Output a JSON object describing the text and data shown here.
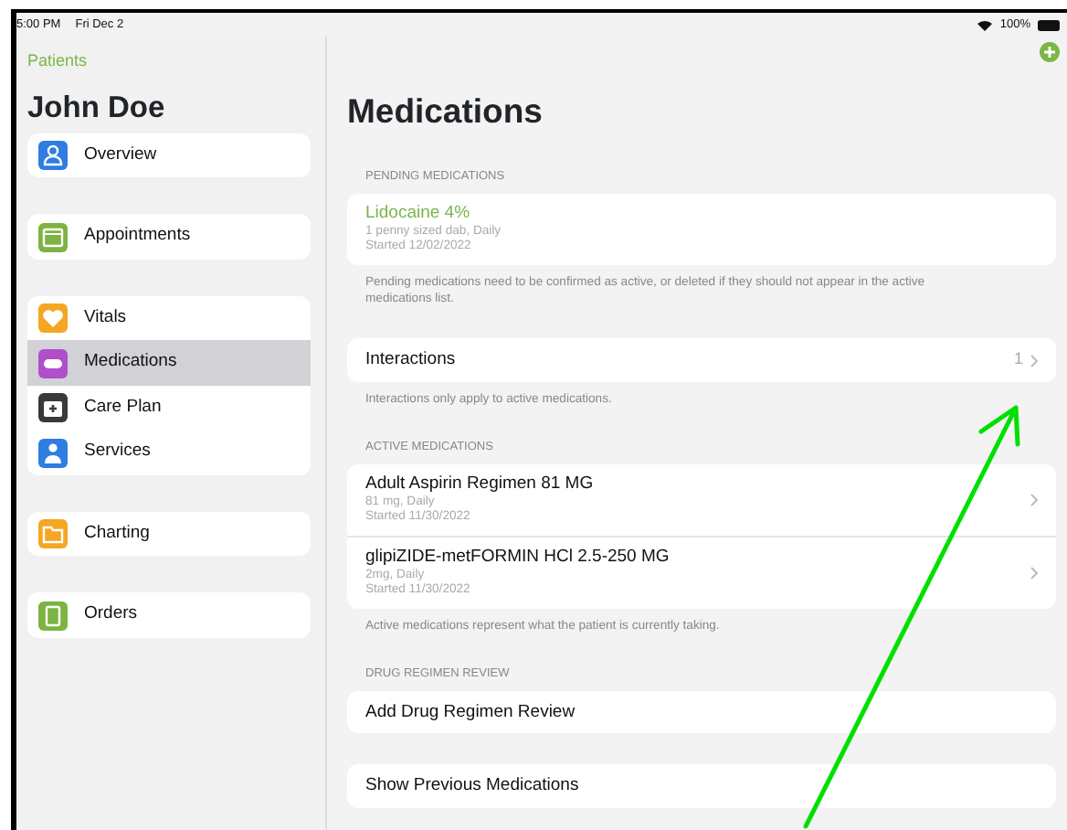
{
  "status_bar": {
    "time": "5:00 PM",
    "date": "Fri Dec 2",
    "battery_text": "100%"
  },
  "sidebar": {
    "back_link": "Patients",
    "patient_name": "John Doe",
    "groups": [
      [
        {
          "label": "Overview",
          "color": "#2f7de1",
          "selected": false
        }
      ],
      [
        {
          "label": "Appointments",
          "color": "#7cb342",
          "selected": false
        }
      ],
      [
        {
          "label": "Vitals",
          "color": "#f5a623",
          "selected": false
        },
        {
          "label": "Medications",
          "color": "#b04fc9",
          "selected": true
        },
        {
          "label": "Care Plan",
          "color": "#3a3a3a",
          "selected": false
        },
        {
          "label": "Services",
          "color": "#2f7de1",
          "selected": false
        }
      ],
      [
        {
          "label": "Charting",
          "color": "#f5a623",
          "selected": false
        }
      ],
      [
        {
          "label": "Orders",
          "color": "#7cb342",
          "selected": false
        }
      ]
    ]
  },
  "main": {
    "title": "Medications",
    "sections": [
      {
        "header": "PENDING MEDICATIONS",
        "rows": [
          {
            "kind": "med",
            "name": "Lidocaine 4%",
            "pending": true,
            "dose": "1 penny sized dab, Daily",
            "started": "Started 12/02/2022",
            "chevron": false
          }
        ],
        "footer": "Pending medications need to be confirmed as active, or deleted if they should not appear in the active medications list."
      },
      {
        "rows": [
          {
            "kind": "count",
            "name": "Interactions",
            "count": "1"
          }
        ],
        "footer": "Interactions only apply to active medications."
      },
      {
        "header": "ACTIVE MEDICATIONS",
        "rows": [
          {
            "kind": "med",
            "name": "Adult Aspirin Regimen 81 MG",
            "pending": false,
            "dose": "81 mg, Daily",
            "started": "Started 11/30/2022",
            "chevron": true
          },
          {
            "kind": "med",
            "name": "glipiZIDE-metFORMIN HCl 2.5-250 MG",
            "pending": false,
            "dose": "2mg, Daily",
            "started": "Started 11/30/2022",
            "chevron": true
          }
        ],
        "footer": "Active medications represent what the patient is currently taking."
      },
      {
        "header": "DRUG REGIMEN REVIEW",
        "rows": [
          {
            "kind": "action",
            "name": "Add Drug Regimen Review"
          }
        ]
      },
      {
        "rows": [
          {
            "kind": "action",
            "name": "Show Previous Medications"
          }
        ]
      }
    ]
  },
  "annotation": {
    "kind": "arrow",
    "color": "#00e000"
  }
}
